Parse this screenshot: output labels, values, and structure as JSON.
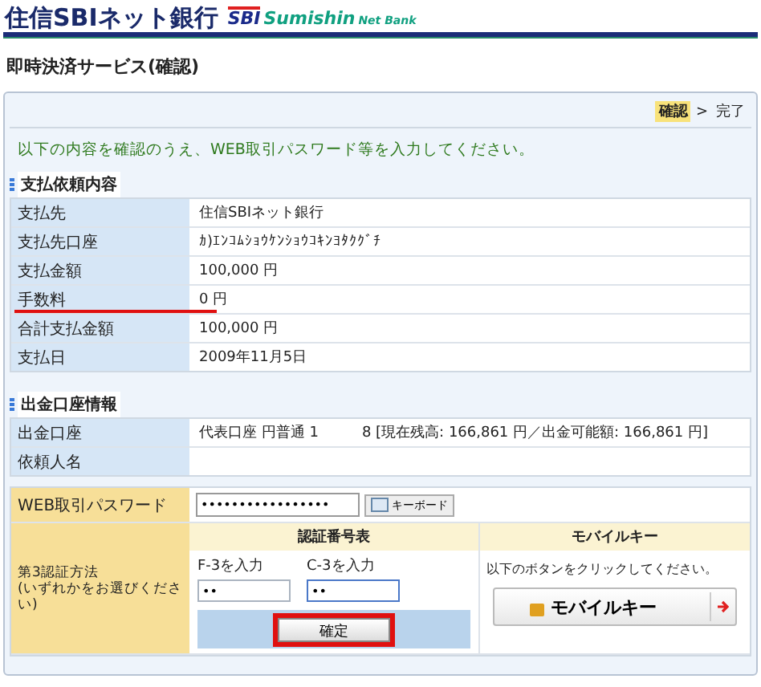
{
  "header": {
    "brand": "住信SBIネット銀行",
    "logo_mark": "SBI",
    "logo_text": "Sumishin",
    "logo_suffix": "Net Bank"
  },
  "page_title": "即時決済サービス(確認)",
  "steps": [
    {
      "label": "確認",
      "selected": true
    },
    {
      "label": "完了",
      "selected": false
    }
  ],
  "step_separator": ">",
  "instruction": "以下の内容を確認のうえ、WEB取引パスワード等を入力してください。",
  "sections": [
    {
      "title": "支払依頼内容",
      "rows": [
        {
          "label": "支払先",
          "value": "住信SBIネット銀行",
          "underlined": false
        },
        {
          "label": "支払先口座",
          "value": "ｶ)ｴﾝｺﾑｼｮｳｹﾝｼｮｳｺｷﾝﾖﾀｸｸﾞﾁ",
          "underlined": false
        },
        {
          "label": "支払金額",
          "value": "100,000 円",
          "underlined": false
        },
        {
          "label": "手数料",
          "value": "0 円",
          "underlined": true
        },
        {
          "label": "合計支払金額",
          "value": "100,000 円",
          "underlined": false
        },
        {
          "label": "支払日",
          "value": "2009年11月5日",
          "underlined": false
        }
      ]
    },
    {
      "title": "出金口座情報",
      "rows": [
        {
          "label": "出金口座",
          "value": "代表口座 円普通 1　　　8 [現在残高: 166,861 円／出金可能額: 166,861 円]",
          "underlined": false
        },
        {
          "label": "依頼人名",
          "underlined": false
        }
      ]
    }
  ],
  "auth": {
    "password_label": "WEB取引パスワード",
    "password_value": "•••••••••••••••••",
    "keyboard_button": "キーボード",
    "method_label": "第3認証方法\n(いずれかをお選びください)",
    "code_table": {
      "title": "認証番号表",
      "fields": [
        {
          "label": "F-3を入力",
          "value": "••",
          "focused": false
        },
        {
          "label": "C-3を入力",
          "value": "••",
          "focused": true
        }
      ],
      "confirm_button": "確定",
      "confirm_highlighted": true
    },
    "mobile": {
      "title": "モバイルキー",
      "text": "以下のボタンをクリックしてください。",
      "button": "モバイルキー"
    }
  }
}
